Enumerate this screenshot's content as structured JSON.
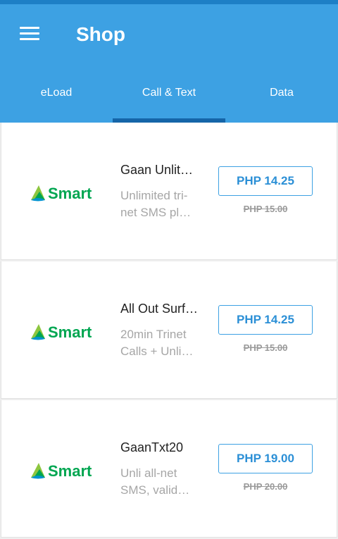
{
  "app": {
    "title": "Shop",
    "accent_color": "#3da1e3",
    "icon": "menu-icon"
  },
  "tabs": [
    {
      "label": "eLoad",
      "active": false
    },
    {
      "label": "Call & Text",
      "active": true
    },
    {
      "label": "Data",
      "active": false
    }
  ],
  "items": [
    {
      "brand": "Smart",
      "name": "Gaan Unlit…",
      "desc_line1": "Unlimited tri-",
      "desc_line2": "net SMS pl…",
      "price": "PHP 14.25",
      "old_price": "PHP 15.00"
    },
    {
      "brand": "Smart",
      "name": "All Out Surf…",
      "desc_line1": "20min Trinet",
      "desc_line2": "Calls + Unli…",
      "price": "PHP 14.25",
      "old_price": "PHP 15.00"
    },
    {
      "brand": "Smart",
      "name": "GaanTxt20",
      "desc_line1": "Unli all-net",
      "desc_line2": "SMS, valid…",
      "price": "PHP 19.00",
      "old_price": "PHP 20.00"
    }
  ]
}
